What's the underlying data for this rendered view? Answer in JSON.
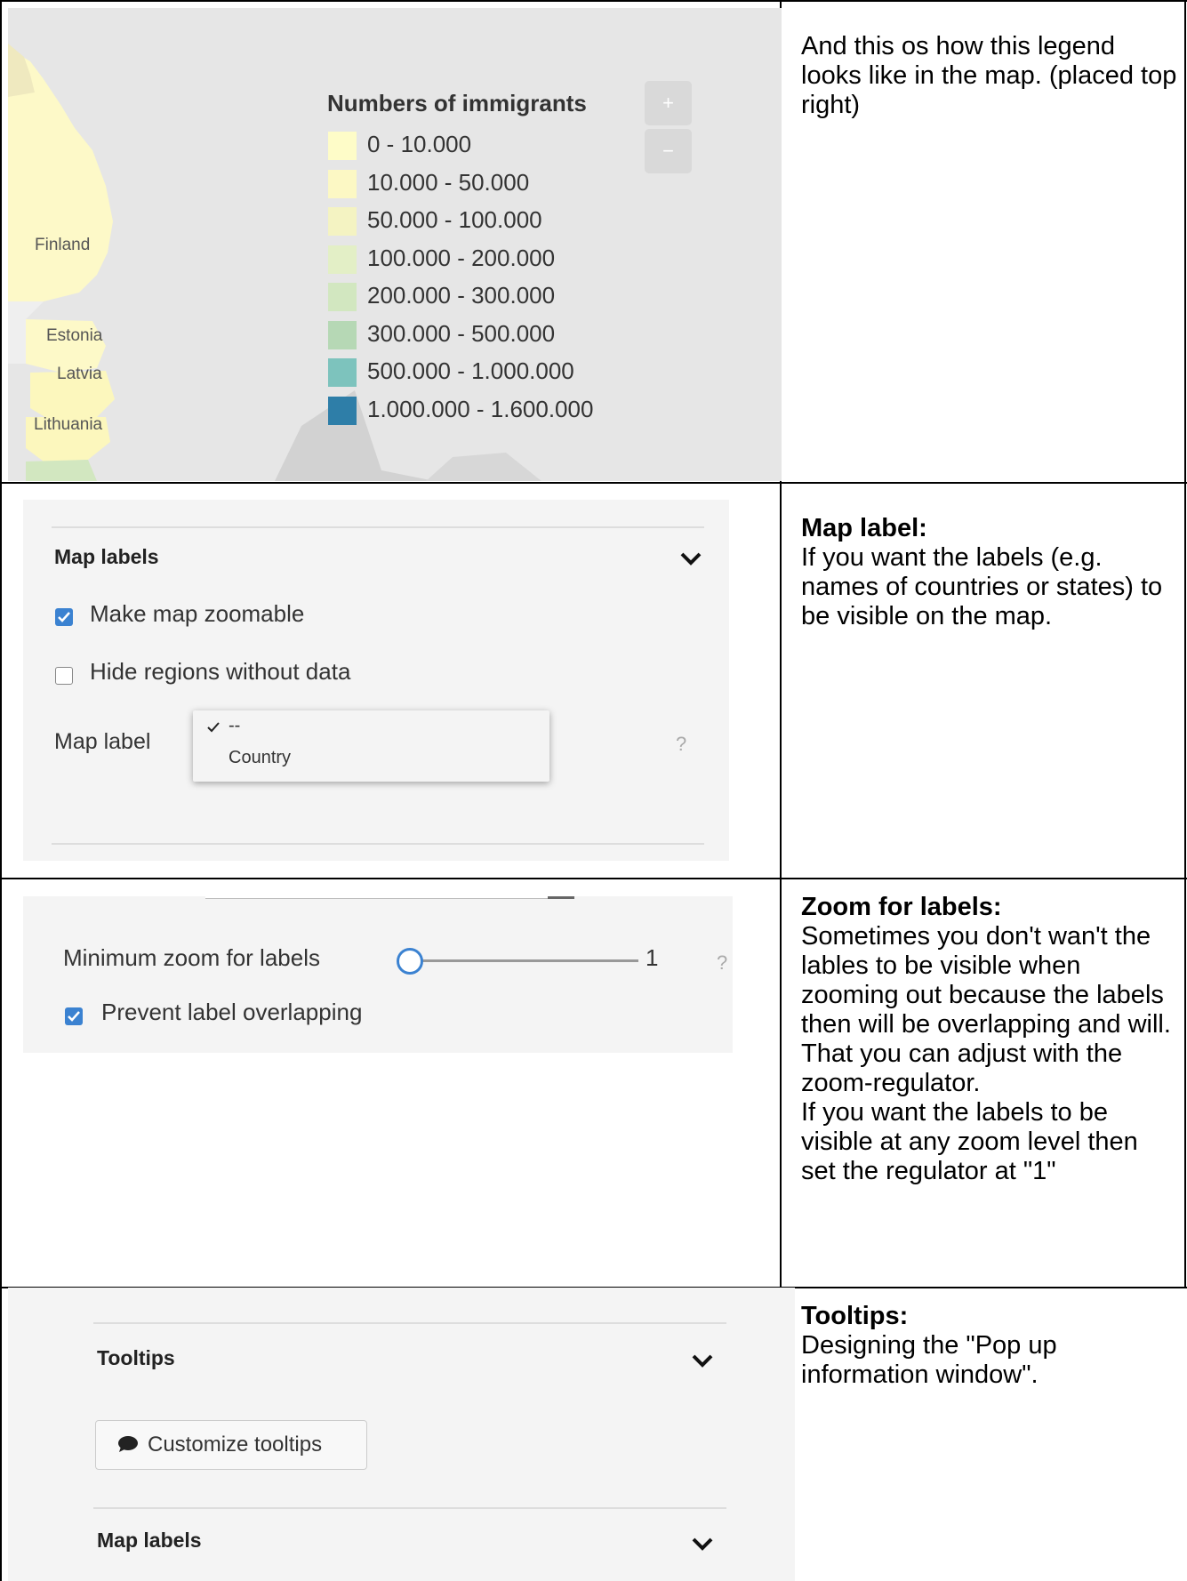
{
  "row1": {
    "legend_title": "Numbers of immigrants",
    "legend_items": [
      {
        "label": "0 - 10.000",
        "color": "#fefcc8"
      },
      {
        "label": "10.000 - 50.000",
        "color": "#fcf8c4"
      },
      {
        "label": "50.000 - 100.000",
        "color": "#f4f3c2"
      },
      {
        "label": "100.000 - 200.000",
        "color": "#e3efc6"
      },
      {
        "label": "200.000 - 300.000",
        "color": "#d2e7c0"
      },
      {
        "label": "300.000 - 500.000",
        "color": "#b6d8b5"
      },
      {
        "label": "500.000 - 1.000.000",
        "color": "#7dc3bd"
      },
      {
        "label": "1.000.000 - 1.600.000",
        "color": "#2e7ea8"
      }
    ],
    "map_labels": [
      "Finland",
      "Estonia",
      "Latvia",
      "Lithuania"
    ],
    "zoom_in": "+",
    "zoom_out": "−",
    "description": "And this os how this legend looks like in the map. (placed top right)"
  },
  "row2": {
    "panel_title": "Map labels",
    "option_zoomable": "Make map zoomable",
    "option_zoomable_checked": true,
    "option_hide": "Hide regions without data",
    "option_hide_checked": false,
    "map_label_field": "Map label",
    "dropdown_options": [
      "--",
      "Country"
    ],
    "dropdown_selected": "--",
    "help": "?",
    "heading": "Map label:",
    "description": "If you want the labels (e.g. names of countries or states) to be visible on the map."
  },
  "row3": {
    "slider_label": "Minimum zoom for labels",
    "slider_value": "1",
    "help": "?",
    "option_prevent": "Prevent label overlapping",
    "option_prevent_checked": true,
    "heading": "Zoom for labels:",
    "description_1": "Sometimes you don't wan't the lables to be visible when zooming out because the labels then will be overlapping and will. That you can adjust with the zoom-regulator.",
    "description_2": "If you want the labels to be visible at any zoom level then set the regulator at \"1\""
  },
  "row4": {
    "panel_title": "Tooltips",
    "button_label": "Customize tooltips",
    "next_panel_title": "Map labels",
    "heading": "Tooltips:",
    "description": "Designing the \"Pop up information window\"."
  }
}
